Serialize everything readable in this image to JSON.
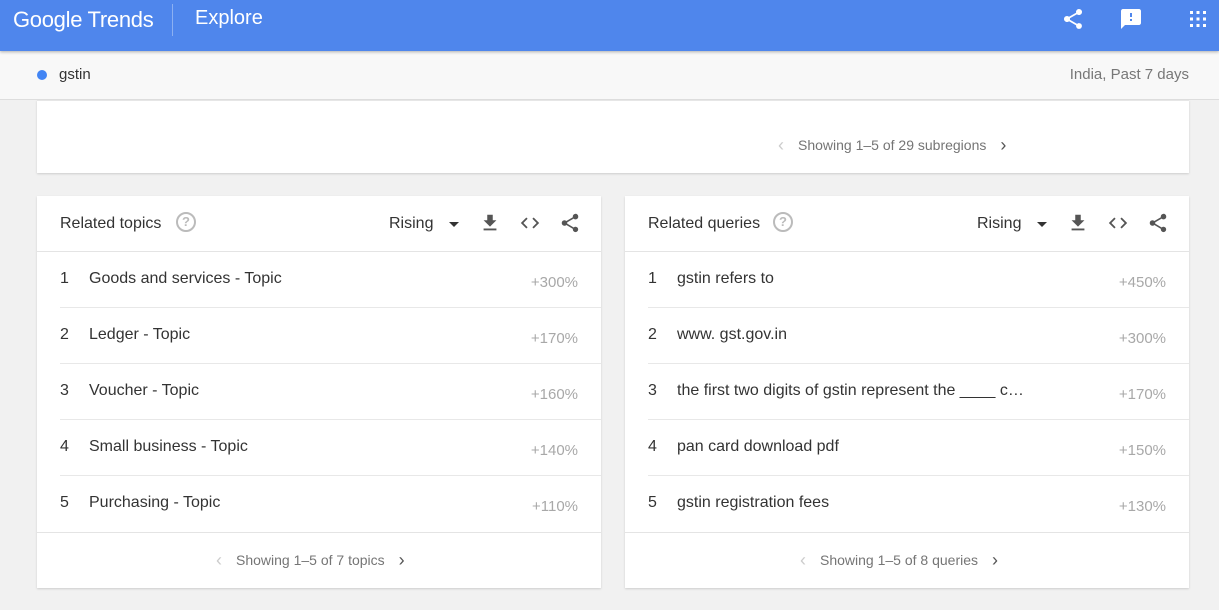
{
  "header": {
    "logo": "Google Trends",
    "section": "Explore",
    "icons": [
      "share-icon",
      "feedback-icon",
      "apps-icon"
    ]
  },
  "term_bar": {
    "term": "gstin",
    "term_color": "#4285f4",
    "meta": "India, Past 7 days"
  },
  "subregions": {
    "pager": "Showing 1–5 of 29 subregions"
  },
  "related_topics": {
    "title": "Related topics",
    "filter": "Rising",
    "rows": [
      {
        "rank": "1",
        "label": "Goods and services - Topic",
        "value": "+300%"
      },
      {
        "rank": "2",
        "label": "Ledger - Topic",
        "value": "+170%"
      },
      {
        "rank": "3",
        "label": "Voucher - Topic",
        "value": "+160%"
      },
      {
        "rank": "4",
        "label": "Small business - Topic",
        "value": "+140%"
      },
      {
        "rank": "5",
        "label": "Purchasing - Topic",
        "value": "+110%"
      }
    ],
    "pager": "Showing 1–5 of 7 topics"
  },
  "related_queries": {
    "title": "Related queries",
    "filter": "Rising",
    "rows": [
      {
        "rank": "1",
        "label": "gstin refers to",
        "value": "+450%"
      },
      {
        "rank": "2",
        "label": "www. gst.gov.in",
        "value": "+300%"
      },
      {
        "rank": "3",
        "label": "the first two digits of gstin represent the ____ c…",
        "value": "+170%"
      },
      {
        "rank": "4",
        "label": "pan card download pdf",
        "value": "+150%"
      },
      {
        "rank": "5",
        "label": "gstin registration fees",
        "value": "+130%"
      }
    ],
    "pager": "Showing 1–5 of 8 queries"
  },
  "colors": {
    "header_bg": "#4f86ec",
    "value_text": "#a8a8a8"
  }
}
